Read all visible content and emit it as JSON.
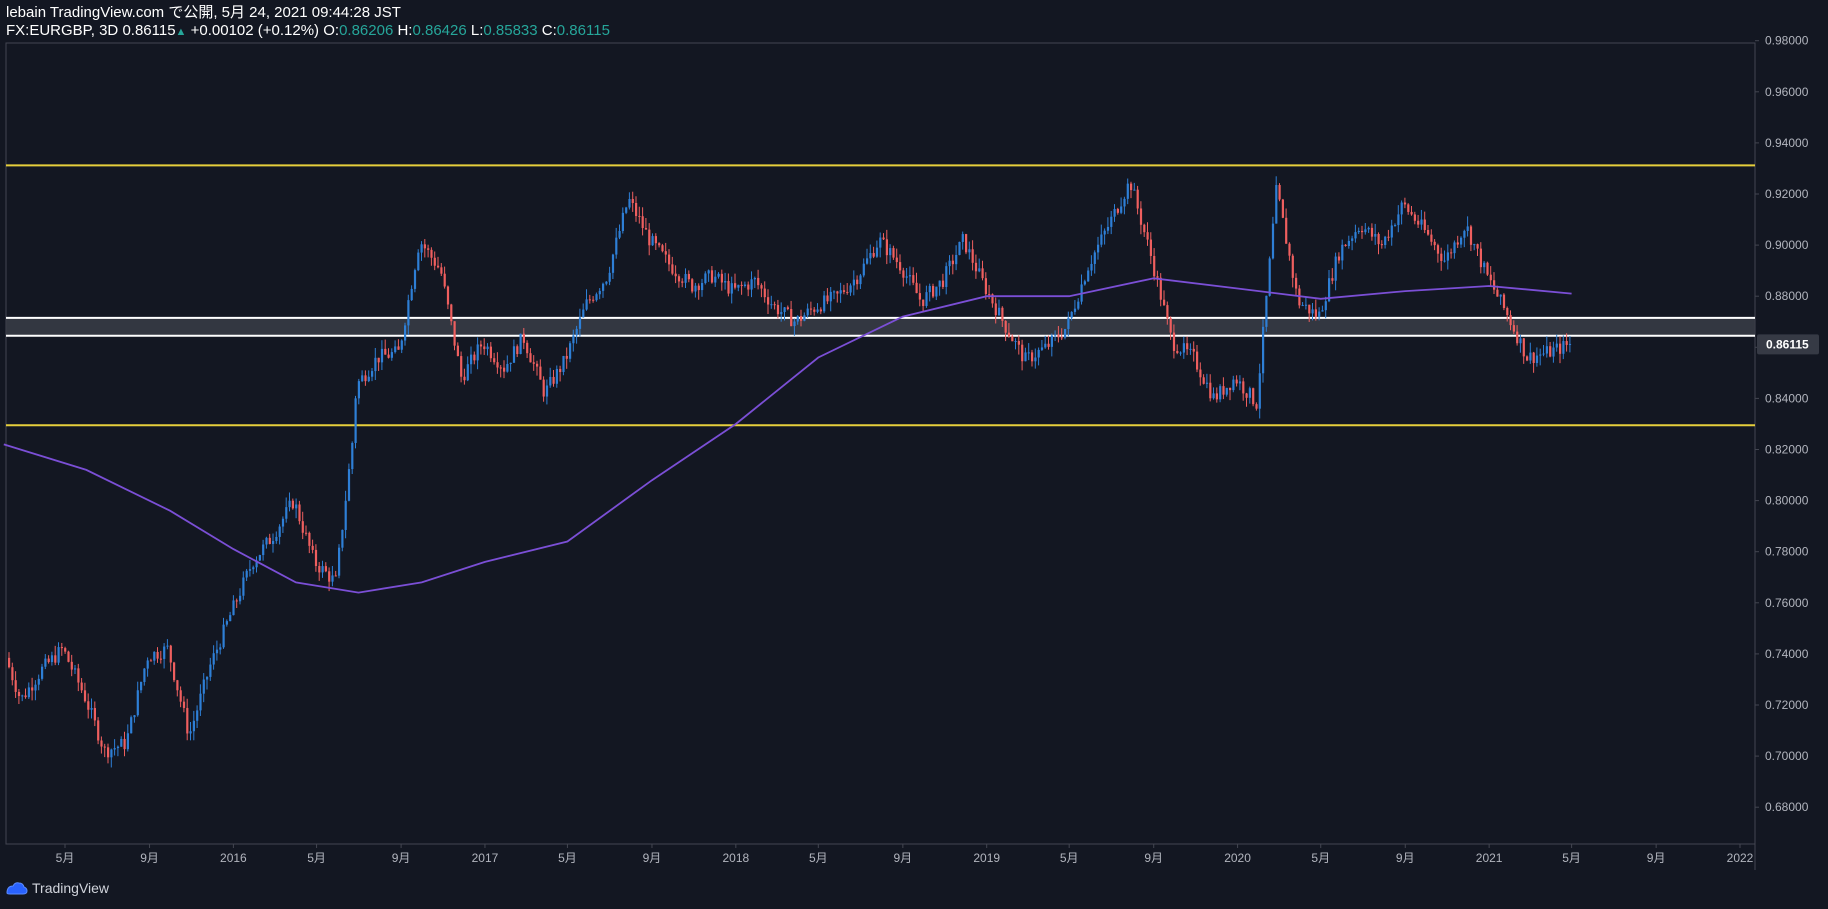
{
  "header": {
    "line1": "lebain TradingView.com で公開, 5月 24, 2021 09:44:28 JST",
    "symbol": "FX:EURGBP, 3D",
    "last": "0.86115",
    "change": "+0.00102 (+0.12%)",
    "o_label": "O:",
    "o_value": "0.86206",
    "h_label": "H:",
    "h_value": "0.86426",
    "l_label": "L:",
    "l_value": "0.85833",
    "c_label": "C:",
    "c_value": "0.86115"
  },
  "footer": {
    "brand": "TradingView",
    "logo_icon": "tradingview-logo-icon"
  },
  "colors": {
    "background": "#131722",
    "up": "#2e7fd6",
    "down": "#ef5f5f",
    "ma": "#7b4fd6",
    "resistance": "#e6cf3c",
    "zone": "#ffffff",
    "axis_text": "#b2b5be",
    "price_badge": "#363a45"
  },
  "chart_data": {
    "type": "candlestick",
    "symbol": "FX:EURGBP",
    "timeframe": "3D",
    "ylim": [
      0.67,
      0.98
    ],
    "y_ticks": [
      "0.98000",
      "0.96000",
      "0.94000",
      "0.92000",
      "0.90000",
      "0.88000",
      "0.86000",
      "0.84000",
      "0.82000",
      "0.80000",
      "0.78000",
      "0.76000",
      "0.74000",
      "0.72000",
      "0.70000",
      "0.68000"
    ],
    "x_ticks": [
      {
        "label": "5月",
        "date": "2015-05"
      },
      {
        "label": "9月",
        "date": "2015-09"
      },
      {
        "label": "2016",
        "date": "2016-01"
      },
      {
        "label": "5月",
        "date": "2016-05"
      },
      {
        "label": "9月",
        "date": "2016-09"
      },
      {
        "label": "2017",
        "date": "2017-01"
      },
      {
        "label": "5月",
        "date": "2017-05"
      },
      {
        "label": "9月",
        "date": "2017-09"
      },
      {
        "label": "2018",
        "date": "2018-01"
      },
      {
        "label": "5月",
        "date": "2018-05"
      },
      {
        "label": "9月",
        "date": "2018-09"
      },
      {
        "label": "2019",
        "date": "2019-01"
      },
      {
        "label": "5月",
        "date": "2019-05"
      },
      {
        "label": "9月",
        "date": "2019-09"
      },
      {
        "label": "2020",
        "date": "2020-01"
      },
      {
        "label": "5月",
        "date": "2020-05"
      },
      {
        "label": "9月",
        "date": "2020-09"
      },
      {
        "label": "2021",
        "date": "2021-01"
      },
      {
        "label": "5月",
        "date": "2021-05"
      },
      {
        "label": "9月",
        "date": "2021-09"
      },
      {
        "label": "2022",
        "date": "2022-01"
      }
    ],
    "last_price_label": "0.86115",
    "horizontal_lines": [
      {
        "name": "resistance",
        "price": 0.9312,
        "color": "#e6cf3c"
      },
      {
        "name": "support",
        "price": 0.8295,
        "color": "#e6cf3c"
      }
    ],
    "zone": {
      "top": 0.8715,
      "bottom": 0.8645
    },
    "closes": [
      {
        "date": "2015-02",
        "close": 0.743
      },
      {
        "date": "2015-03",
        "close": 0.722
      },
      {
        "date": "2015-04",
        "close": 0.734
      },
      {
        "date": "2015-05",
        "close": 0.742
      },
      {
        "date": "2015-06",
        "close": 0.724
      },
      {
        "date": "2015-07",
        "close": 0.702
      },
      {
        "date": "2015-08",
        "close": 0.705
      },
      {
        "date": "2015-09",
        "close": 0.739
      },
      {
        "date": "2015-10",
        "close": 0.742
      },
      {
        "date": "2015-11",
        "close": 0.708
      },
      {
        "date": "2015-12",
        "close": 0.735
      },
      {
        "date": "2016-01",
        "close": 0.756
      },
      {
        "date": "2016-02",
        "close": 0.776
      },
      {
        "date": "2016-03",
        "close": 0.786
      },
      {
        "date": "2016-04",
        "close": 0.8
      },
      {
        "date": "2016-05",
        "close": 0.776
      },
      {
        "date": "2016-06",
        "close": 0.768
      },
      {
        "date": "2016-06-25",
        "close": 0.822
      },
      {
        "date": "2016-07",
        "close": 0.845
      },
      {
        "date": "2016-08",
        "close": 0.856
      },
      {
        "date": "2016-09",
        "close": 0.858
      },
      {
        "date": "2016-10",
        "close": 0.902
      },
      {
        "date": "2016-11",
        "close": 0.89
      },
      {
        "date": "2016-12",
        "close": 0.848
      },
      {
        "date": "2017-01",
        "close": 0.862
      },
      {
        "date": "2017-02",
        "close": 0.852
      },
      {
        "date": "2017-03",
        "close": 0.864
      },
      {
        "date": "2017-04",
        "close": 0.842
      },
      {
        "date": "2017-05",
        "close": 0.855
      },
      {
        "date": "2017-06",
        "close": 0.877
      },
      {
        "date": "2017-07",
        "close": 0.888
      },
      {
        "date": "2017-08",
        "close": 0.918
      },
      {
        "date": "2017-09",
        "close": 0.902
      },
      {
        "date": "2017-10",
        "close": 0.892
      },
      {
        "date": "2017-11",
        "close": 0.884
      },
      {
        "date": "2017-12",
        "close": 0.888
      },
      {
        "date": "2018-01",
        "close": 0.882
      },
      {
        "date": "2018-02",
        "close": 0.886
      },
      {
        "date": "2018-03",
        "close": 0.876
      },
      {
        "date": "2018-04",
        "close": 0.87
      },
      {
        "date": "2018-05",
        "close": 0.876
      },
      {
        "date": "2018-06",
        "close": 0.88
      },
      {
        "date": "2018-07",
        "close": 0.888
      },
      {
        "date": "2018-08",
        "close": 0.902
      },
      {
        "date": "2018-09",
        "close": 0.892
      },
      {
        "date": "2018-10",
        "close": 0.878
      },
      {
        "date": "2018-11",
        "close": 0.886
      },
      {
        "date": "2018-12",
        "close": 0.902
      },
      {
        "date": "2019-01",
        "close": 0.884
      },
      {
        "date": "2019-02",
        "close": 0.868
      },
      {
        "date": "2019-03",
        "close": 0.855
      },
      {
        "date": "2019-04",
        "close": 0.86
      },
      {
        "date": "2019-05",
        "close": 0.868
      },
      {
        "date": "2019-06",
        "close": 0.892
      },
      {
        "date": "2019-07",
        "close": 0.908
      },
      {
        "date": "2019-08",
        "close": 0.925
      },
      {
        "date": "2019-09",
        "close": 0.895
      },
      {
        "date": "2019-10",
        "close": 0.862
      },
      {
        "date": "2019-11",
        "close": 0.856
      },
      {
        "date": "2019-12",
        "close": 0.84
      },
      {
        "date": "2020-01",
        "close": 0.848
      },
      {
        "date": "2020-02",
        "close": 0.838
      },
      {
        "date": "2020-03",
        "close": 0.922
      },
      {
        "date": "2020-04",
        "close": 0.878
      },
      {
        "date": "2020-05",
        "close": 0.872
      },
      {
        "date": "2020-06",
        "close": 0.898
      },
      {
        "date": "2020-07",
        "close": 0.908
      },
      {
        "date": "2020-08",
        "close": 0.9
      },
      {
        "date": "2020-09",
        "close": 0.916
      },
      {
        "date": "2020-10",
        "close": 0.906
      },
      {
        "date": "2020-11",
        "close": 0.894
      },
      {
        "date": "2020-12",
        "close": 0.908
      },
      {
        "date": "2021-01",
        "close": 0.888
      },
      {
        "date": "2021-02",
        "close": 0.872
      },
      {
        "date": "2021-03",
        "close": 0.856
      },
      {
        "date": "2021-04",
        "close": 0.858
      },
      {
        "date": "2021-05",
        "close": 0.86115
      }
    ],
    "moving_average": [
      {
        "date": "2015-02",
        "value": 0.822
      },
      {
        "date": "2015-06",
        "value": 0.812
      },
      {
        "date": "2015-10",
        "value": 0.796
      },
      {
        "date": "2016-01",
        "value": 0.781
      },
      {
        "date": "2016-04",
        "value": 0.768
      },
      {
        "date": "2016-07",
        "value": 0.764
      },
      {
        "date": "2016-10",
        "value": 0.768
      },
      {
        "date": "2017-01",
        "value": 0.776
      },
      {
        "date": "2017-05",
        "value": 0.784
      },
      {
        "date": "2017-09",
        "value": 0.808
      },
      {
        "date": "2018-01",
        "value": 0.83
      },
      {
        "date": "2018-05",
        "value": 0.856
      },
      {
        "date": "2018-09",
        "value": 0.872
      },
      {
        "date": "2019-01",
        "value": 0.88
      },
      {
        "date": "2019-05",
        "value": 0.88
      },
      {
        "date": "2019-09",
        "value": 0.887
      },
      {
        "date": "2020-01",
        "value": 0.883
      },
      {
        "date": "2020-05",
        "value": 0.879
      },
      {
        "date": "2020-09",
        "value": 0.882
      },
      {
        "date": "2021-01",
        "value": 0.884
      },
      {
        "date": "2021-05",
        "value": 0.881
      }
    ]
  }
}
